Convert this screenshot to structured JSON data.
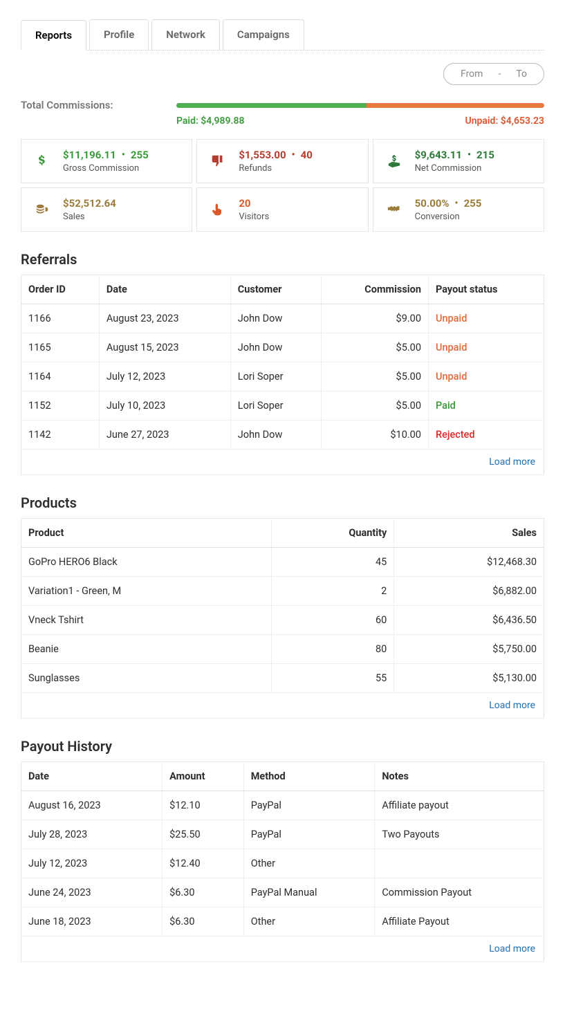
{
  "tabs": [
    {
      "label": "Reports",
      "active": true
    },
    {
      "label": "Profile",
      "active": false
    },
    {
      "label": "Network",
      "active": false
    },
    {
      "label": "Campaigns",
      "active": false
    }
  ],
  "date_range": {
    "from": "From",
    "sep": "-",
    "to": "To"
  },
  "total_commissions": {
    "label": "Total Commissions:",
    "paid_label": "Paid: $4,989.88",
    "unpaid_label": "Unpaid: $4,653.23",
    "paid_pct": 51.7
  },
  "cards": [
    {
      "icon": "dollar",
      "color": "c-green",
      "value": "$11,196.11",
      "count": "255",
      "label": "Gross Commission"
    },
    {
      "icon": "thumbs-down",
      "color": "c-red",
      "value": "$1,553.00",
      "count": "40",
      "label": "Refunds"
    },
    {
      "icon": "hand-dollar",
      "color": "c-darkgreen",
      "value": "$9,643.11",
      "count": "215",
      "label": "Net Commission"
    },
    {
      "icon": "coins",
      "color": "c-brown",
      "value": "$52,512.64",
      "count": "",
      "label": "Sales"
    },
    {
      "icon": "point-up",
      "color": "c-orange",
      "value": "20",
      "count": "",
      "label": "Visitors"
    },
    {
      "icon": "handshake",
      "color": "c-brown",
      "value": "50.00%",
      "count": "255",
      "label": "Conversion"
    }
  ],
  "referrals": {
    "title": "Referrals",
    "headers": [
      "Order ID",
      "Date",
      "Customer",
      "Commission",
      "Payout status"
    ],
    "rows": [
      {
        "id": "1166",
        "date": "August 23, 2023",
        "customer": "John Dow",
        "commission": "$9.00",
        "status": "Unpaid",
        "status_cls": "status-unpaid"
      },
      {
        "id": "1165",
        "date": "August 15, 2023",
        "customer": "John Dow",
        "commission": "$5.00",
        "status": "Unpaid",
        "status_cls": "status-unpaid"
      },
      {
        "id": "1164",
        "date": "July 12, 2023",
        "customer": "Lori Soper",
        "commission": "$5.00",
        "status": "Unpaid",
        "status_cls": "status-unpaid"
      },
      {
        "id": "1152",
        "date": "July 10, 2023",
        "customer": "Lori Soper",
        "commission": "$5.00",
        "status": "Paid",
        "status_cls": "status-paid"
      },
      {
        "id": "1142",
        "date": "June 27, 2023",
        "customer": "John Dow",
        "commission": "$10.00",
        "status": "Rejected",
        "status_cls": "status-rejected"
      }
    ],
    "load_more": "Load more"
  },
  "products": {
    "title": "Products",
    "headers": [
      "Product",
      "Quantity",
      "Sales"
    ],
    "rows": [
      {
        "product": "GoPro HERO6 Black",
        "qty": "45",
        "sales": "$12,468.30"
      },
      {
        "product": "Variation1 - Green, M",
        "qty": "2",
        "sales": "$6,882.00"
      },
      {
        "product": "Vneck Tshirt",
        "qty": "60",
        "sales": "$6,436.50"
      },
      {
        "product": "Beanie",
        "qty": "80",
        "sales": "$5,750.00"
      },
      {
        "product": "Sunglasses",
        "qty": "55",
        "sales": "$5,130.00"
      }
    ],
    "load_more": "Load more"
  },
  "payouts": {
    "title": "Payout History",
    "headers": [
      "Date",
      "Amount",
      "Method",
      "Notes"
    ],
    "rows": [
      {
        "date": "August 16, 2023",
        "amount": "$12.10",
        "method": "PayPal",
        "notes": "Affiliate payout"
      },
      {
        "date": "July 28, 2023",
        "amount": "$25.50",
        "method": "PayPal",
        "notes": "Two Payouts"
      },
      {
        "date": "July 12, 2023",
        "amount": "$12.40",
        "method": "Other",
        "notes": ""
      },
      {
        "date": "June 24, 2023",
        "amount": "$6.30",
        "method": "PayPal Manual",
        "notes": "Commission Payout"
      },
      {
        "date": "June 18, 2023",
        "amount": "$6.30",
        "method": "Other",
        "notes": "Affiliate Payout"
      }
    ],
    "load_more": "Load more"
  }
}
